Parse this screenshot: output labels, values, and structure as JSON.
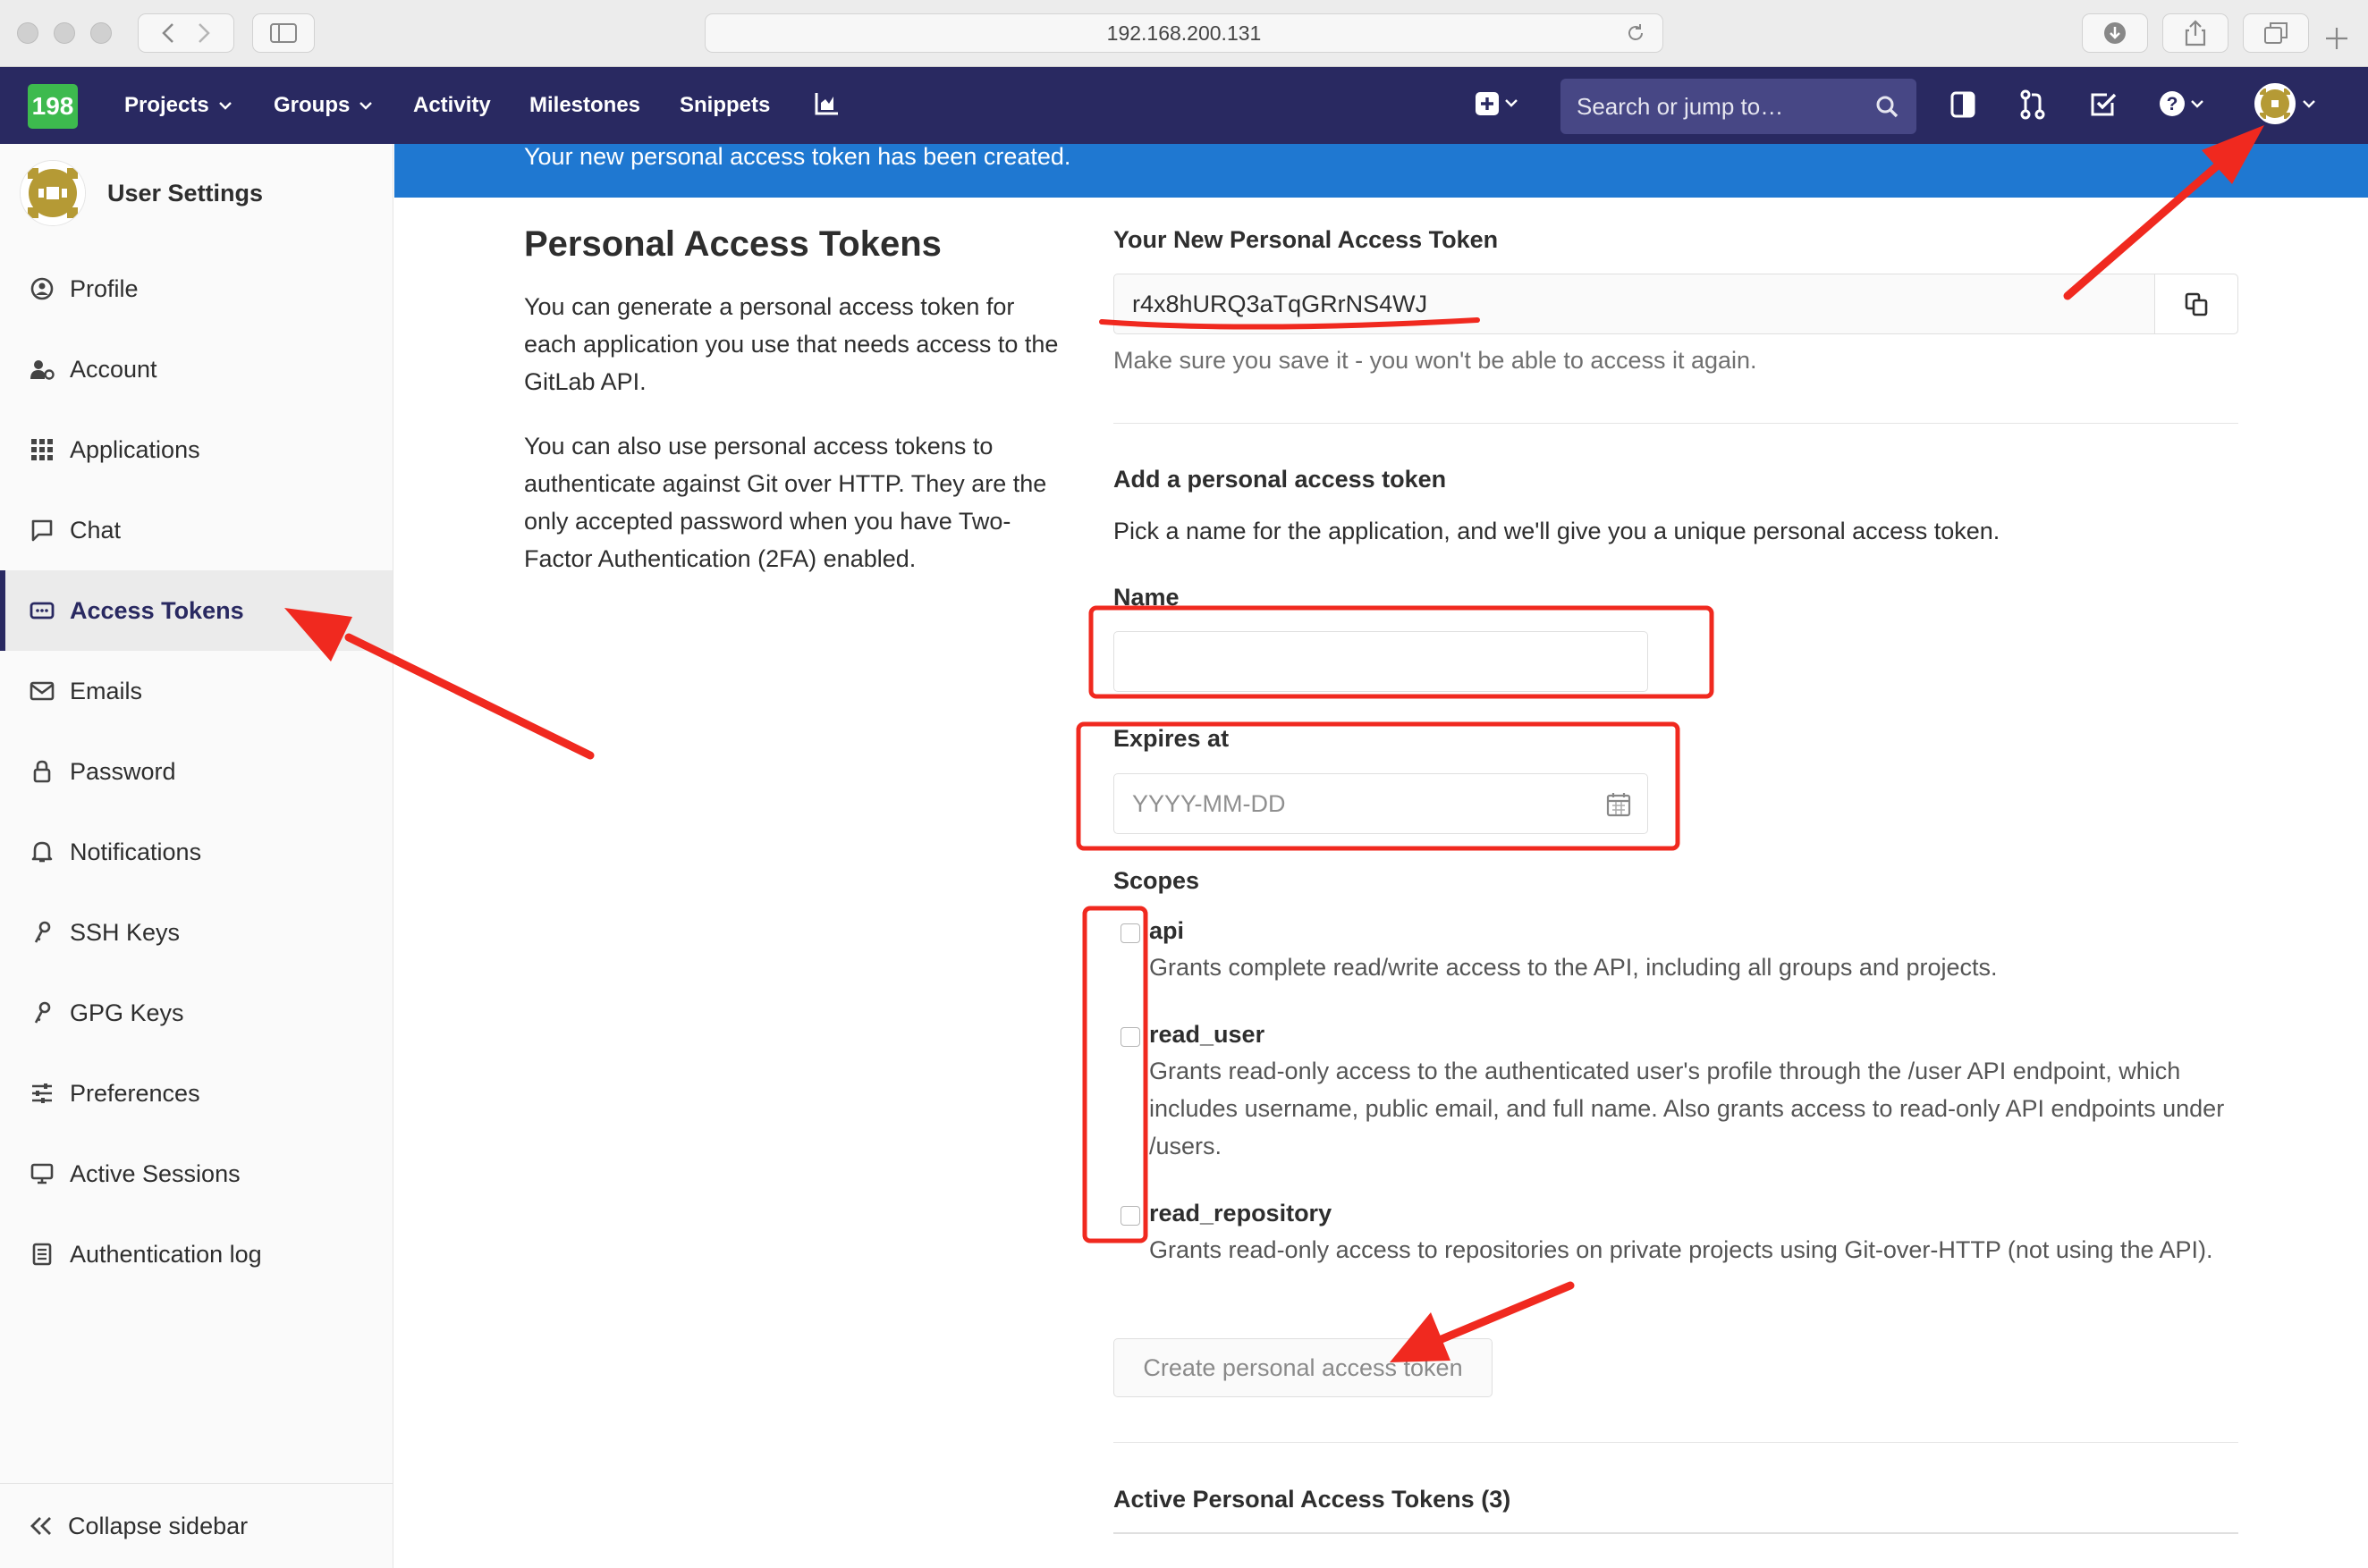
{
  "browser": {
    "address": "192.168.200.131"
  },
  "navbar": {
    "logo_text": "198",
    "links": [
      "Projects",
      "Groups",
      "Activity",
      "Milestones",
      "Snippets"
    ],
    "search_placeholder": "Search or jump to…"
  },
  "sidebar": {
    "title": "User Settings",
    "items": [
      {
        "label": "Profile",
        "icon": "profile-icon"
      },
      {
        "label": "Account",
        "icon": "account-icon"
      },
      {
        "label": "Applications",
        "icon": "applications-icon"
      },
      {
        "label": "Chat",
        "icon": "chat-icon"
      },
      {
        "label": "Access Tokens",
        "icon": "access-tokens-icon",
        "active": true
      },
      {
        "label": "Emails",
        "icon": "email-icon"
      },
      {
        "label": "Password",
        "icon": "lock-icon"
      },
      {
        "label": "Notifications",
        "icon": "bell-icon"
      },
      {
        "label": "SSH Keys",
        "icon": "key-icon"
      },
      {
        "label": "GPG Keys",
        "icon": "key-icon"
      },
      {
        "label": "Preferences",
        "icon": "sliders-icon"
      },
      {
        "label": "Active Sessions",
        "icon": "monitor-icon"
      },
      {
        "label": "Authentication log",
        "icon": "log-icon"
      }
    ],
    "collapse_label": "Collapse sidebar"
  },
  "flash": {
    "message": "Your new personal access token has been created."
  },
  "intro": {
    "title": "Personal Access Tokens",
    "paragraph1": "You can generate a personal access token for each application you use that needs access to the GitLab API.",
    "paragraph2": "You can also use personal access tokens to authenticate against Git over HTTP. They are the only accepted password when you have Two-Factor Authentication (2FA) enabled."
  },
  "new_token": {
    "label": "Your New Personal Access Token",
    "value": "r4x8hURQ3aTqGRrNS4WJ",
    "hint": "Make sure you save it - you won't be able to access it again."
  },
  "form": {
    "heading": "Add a personal access token",
    "description": "Pick a name for the application, and we'll give you a unique personal access token.",
    "name_label": "Name",
    "name_value": "",
    "expires_label": "Expires at",
    "expires_placeholder": "YYYY-MM-DD",
    "scopes_label": "Scopes",
    "scopes": [
      {
        "name": "api",
        "checked": false,
        "desc": "Grants complete read/write access to the API, including all groups and projects."
      },
      {
        "name": "read_user",
        "checked": false,
        "desc": "Grants read-only access to the authenticated user's profile through the /user API endpoint, which includes username, public email, and full name. Also grants access to read-only API endpoints under /users."
      },
      {
        "name": "read_repository",
        "checked": false,
        "desc": "Grants read-only access to repositories on private projects using Git-over-HTTP (not using the API)."
      }
    ],
    "submit_label": "Create personal access token"
  },
  "active_tokens": {
    "heading": "Active Personal Access Tokens (3)"
  },
  "colors": {
    "navbar": "#292961",
    "flash": "#1f78d1",
    "annotation": "#f0291f"
  }
}
